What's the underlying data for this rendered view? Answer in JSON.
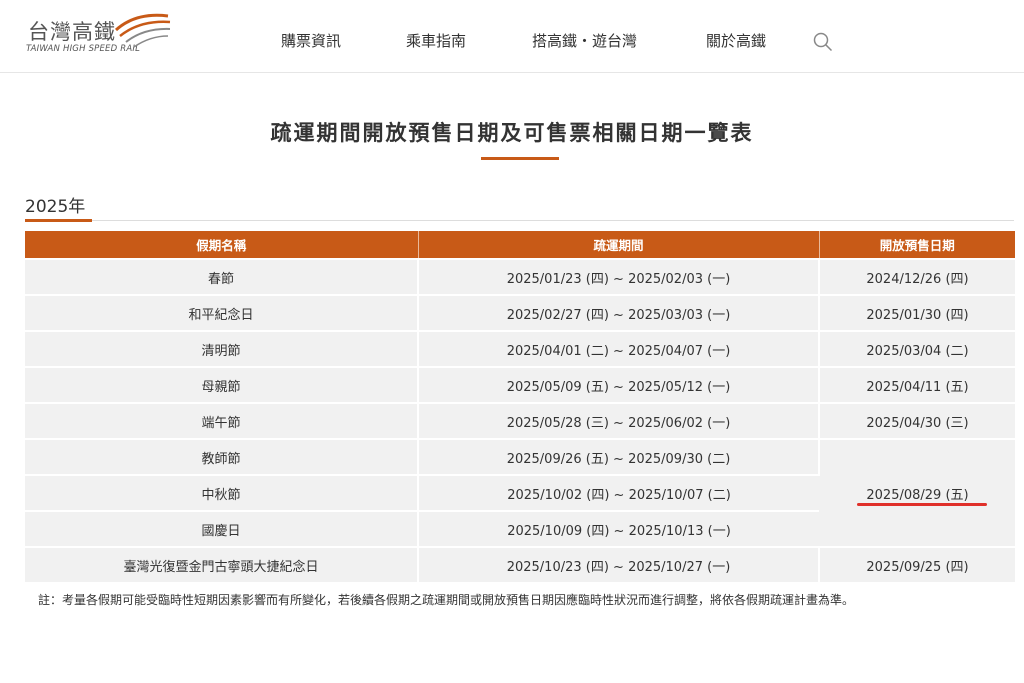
{
  "header": {
    "logo_zh": "台灣高鐵",
    "logo_en": "TAIWAN HIGH SPEED RAIL",
    "nav": [
      {
        "label": "購票資訊"
      },
      {
        "label": "乘車指南"
      },
      {
        "label": "搭高鐵・遊台灣"
      },
      {
        "label": "關於高鐵"
      }
    ],
    "search_icon": "search-icon"
  },
  "page": {
    "title": "疏運期間開放預售日期及可售票相關日期一覽表",
    "year": "2025年"
  },
  "table": {
    "headers": [
      "假期名稱",
      "疏運期間",
      "開放預售日期"
    ],
    "rows": [
      {
        "holiday": "春節",
        "period": "2025/01/23 (四) ~ 2025/02/03 (一)",
        "presale": "2024/12/26 (四)"
      },
      {
        "holiday": "和平紀念日",
        "period": "2025/02/27 (四) ~ 2025/03/03 (一)",
        "presale": "2025/01/30 (四)"
      },
      {
        "holiday": "清明節",
        "period": "2025/04/01 (二) ~ 2025/04/07 (一)",
        "presale": "2025/03/04 (二)"
      },
      {
        "holiday": "母親節",
        "period": "2025/05/09 (五) ~ 2025/05/12 (一)",
        "presale": "2025/04/11 (五)"
      },
      {
        "holiday": "端午節",
        "period": "2025/05/28 (三) ~ 2025/06/02 (一)",
        "presale": "2025/04/30 (三)"
      },
      {
        "holiday": "教師節",
        "period": "2025/09/26 (五) ~ 2025/09/30 (二)"
      },
      {
        "holiday": "中秋節",
        "period": "2025/10/02 (四) ~ 2025/10/07 (二)"
      },
      {
        "holiday": "國慶日",
        "period": "2025/10/09 (四) ~ 2025/10/13 (一)"
      },
      {
        "holiday": "臺灣光復暨金門古寧頭大捷紀念日",
        "period": "2025/10/23 (四) ~ 2025/10/27 (一)",
        "presale": "2025/09/25 (四)"
      }
    ],
    "merged_presale": "2025/08/29 (五)"
  },
  "note": "註：考量各假期可能受臨時性短期因素影響而有所變化，若後續各假期之疏運期間或開放預售日期因應臨時性狀況而進行調整，將依各假期疏運計畫為準。",
  "colors": {
    "accent": "#c85a17",
    "highlight": "#e0302a",
    "row_bg": "#f1f1f1"
  }
}
